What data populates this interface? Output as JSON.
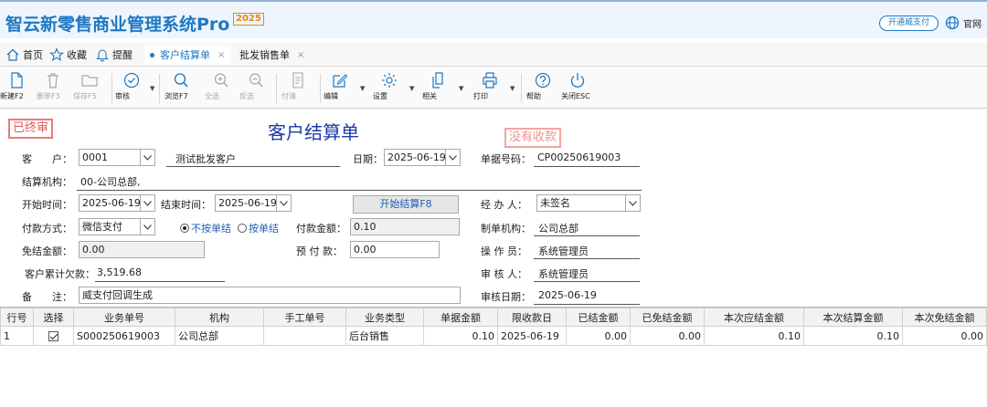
{
  "app": {
    "title": "智云新零售商业管理系统Pro",
    "year_badge": "2025",
    "pay_button": "开通威支付",
    "site_link": "官网"
  },
  "nav": {
    "home": "首页",
    "favorites": "收藏",
    "reminders": "提醒",
    "tabs": [
      {
        "label": "客户结算单",
        "active": true,
        "close": "×"
      },
      {
        "label": "批发销售单",
        "active": false,
        "close": "×"
      }
    ]
  },
  "toolbar": {
    "new": "新建F2",
    "delete": "删单F3",
    "save": "保存F5",
    "audit": "审核",
    "browse": "浏览F7",
    "select_all": "全选",
    "invert": "反选",
    "pay": "付清",
    "edit": "编辑",
    "settings": "设置",
    "related": "相关",
    "print": "打印",
    "help": "帮助",
    "close": "关闭ESC"
  },
  "form": {
    "stamp_final": "已终审",
    "stamp_unpaid": "没有收款",
    "title": "客户结算单",
    "customer_label": "客　　户：",
    "customer_code": "0001",
    "customer_name": "测试批发客户",
    "date_label": "日期：",
    "date_value": "2025-06-19",
    "doc_no_label": "单据号码：",
    "doc_no_value": "CP00250619003",
    "org_label": "结算机构：",
    "org_value": "00-公司总部,",
    "start_label": "开始时间：",
    "start_value": "2025-06-19",
    "end_label": "结束时间：",
    "end_value": "2025-06-19",
    "start_button": "开始结算F8",
    "handler_label": "经 办 人：",
    "handler_value": "未签名",
    "paymethod_label": "付款方式：",
    "paymethod_value": "微信支付",
    "radio_not_by_bill": "不按单结",
    "radio_by_bill": "按单结",
    "payamount_label": "付款金额：",
    "payamount_value": "0.10",
    "maker_org_label": "制单机构：",
    "maker_org_value": "公司总部",
    "waive_label": "免结金额：",
    "waive_value": "0.00",
    "prepay_label": "预 付 款：",
    "prepay_value": "0.00",
    "operator_label": "操 作 员：",
    "operator_value": "系统管理员",
    "arrears_label": "客户累计欠款：",
    "arrears_value": "3,519.68",
    "reviewer_label": "审 核 人：",
    "reviewer_value": "系统管理员",
    "remark_label": "备　　注：",
    "remark_value": "威支付回调生成",
    "audit_date_label": "审核日期：",
    "audit_date_value": "2025-06-19"
  },
  "grid": {
    "columns": [
      "行号",
      "选择",
      "业务单号",
      "机构",
      "手工单号",
      "业务类型",
      "单据金额",
      "限收款日",
      "已结金额",
      "已免结金额",
      "本次应结金额",
      "本次结算金额",
      "本次免结金额"
    ],
    "rows": [
      {
        "row_no": "1",
        "checked": true,
        "biz_no": "S000250619003",
        "org": "公司总部",
        "manual_no": "",
        "biz_type": "后台销售",
        "amount": "0.10",
        "due_date": "2025-06-19",
        "settled": "0.00",
        "waived": "0.00",
        "should_settle": "0.10",
        "this_settle": "0.10",
        "this_waive": "0.00"
      }
    ]
  },
  "colors": {
    "brand": "#1f78c4",
    "title_blue": "#1a3aa8",
    "stamp_red": "#e05a5a"
  }
}
